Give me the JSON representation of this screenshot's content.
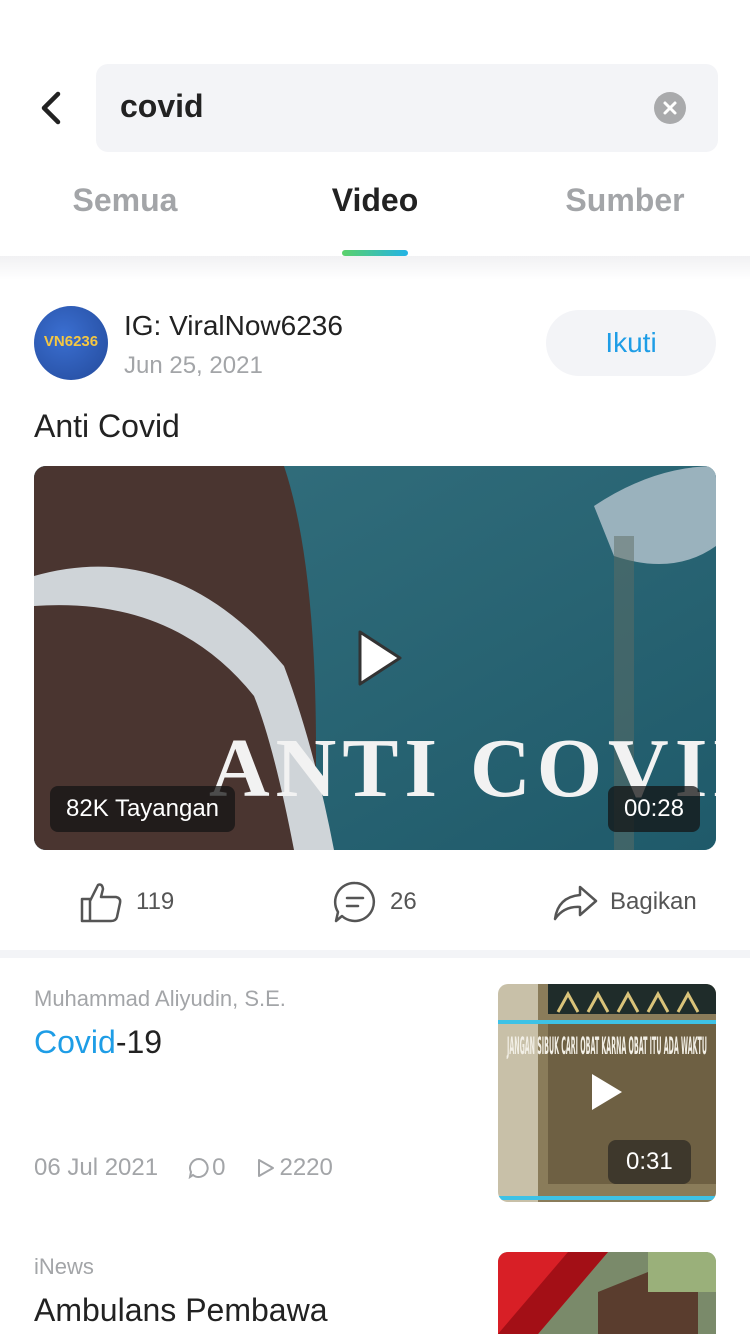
{
  "search": {
    "query": "covid"
  },
  "tabs": [
    {
      "label": "Semua"
    },
    {
      "label": "Video"
    },
    {
      "label": "Sumber"
    }
  ],
  "tabs_active_index": 1,
  "featured": {
    "avatar_text": "VN6236",
    "author": "IG: ViralNow6236",
    "date": "Jun 25, 2021",
    "follow_label": "Ikuti",
    "title": "Anti Covid",
    "video_text": "ANTI COVID",
    "views": "82K Tayangan",
    "duration": "00:28",
    "likes": "119",
    "comments": "26",
    "share_label": "Bagikan"
  },
  "results": [
    {
      "source": "Muhammad Aliyudin, S.E.",
      "title_highlight": "Covid",
      "title_rest": "-19",
      "date": "06 Jul 2021",
      "comments": "0",
      "plays": "2220",
      "thumb_text": "JANGAN SIBUK CARI OBAT KARNA OBAT ITU ADA WAKTU",
      "duration": "0:31"
    },
    {
      "source": "iNews",
      "title": "Ambulans Pembawa"
    }
  ],
  "colors": {
    "accent": "#1e9de6",
    "tab_gradient_start": "#5bd16a",
    "tab_gradient_end": "#22b3e6"
  }
}
